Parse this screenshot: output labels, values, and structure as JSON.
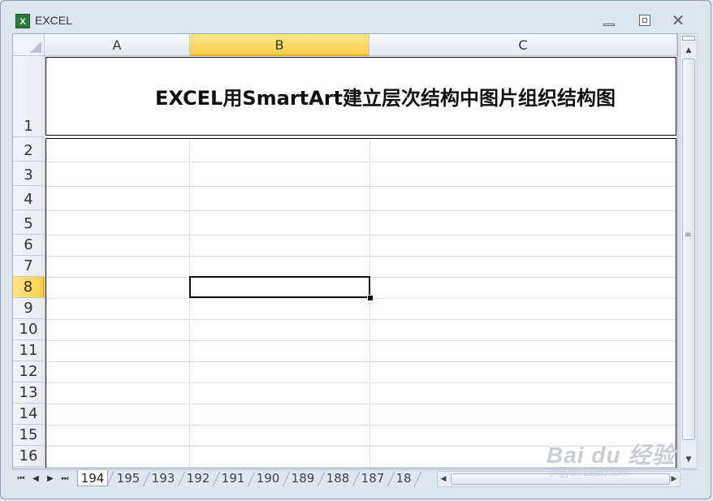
{
  "window": {
    "title": "EXCEL",
    "app_icon_glyph": "X"
  },
  "sheet": {
    "columns": [
      {
        "label": "A",
        "selected": false
      },
      {
        "label": "B",
        "selected": true
      },
      {
        "label": "C",
        "selected": false
      }
    ],
    "rows": [
      "1",
      "2",
      "3",
      "4",
      "5",
      "6",
      "7",
      "8",
      "9",
      "10",
      "11",
      "12",
      "13",
      "14",
      "15",
      "16"
    ],
    "selected_row": "8",
    "title_cell": "EXCEL用SmartArt建立层次结构中图片组织结构图"
  },
  "tabs": {
    "items": [
      "194",
      "195",
      "193",
      "192",
      "191",
      "190",
      "189",
      "188",
      "187",
      "18"
    ],
    "active": "194"
  },
  "watermark": {
    "main": "Bai du 经验",
    "sub": "jingyan.baidu.com"
  },
  "colors": {
    "selected_header": "#f8cf4d",
    "grid_line": "#dcdfe3"
  }
}
